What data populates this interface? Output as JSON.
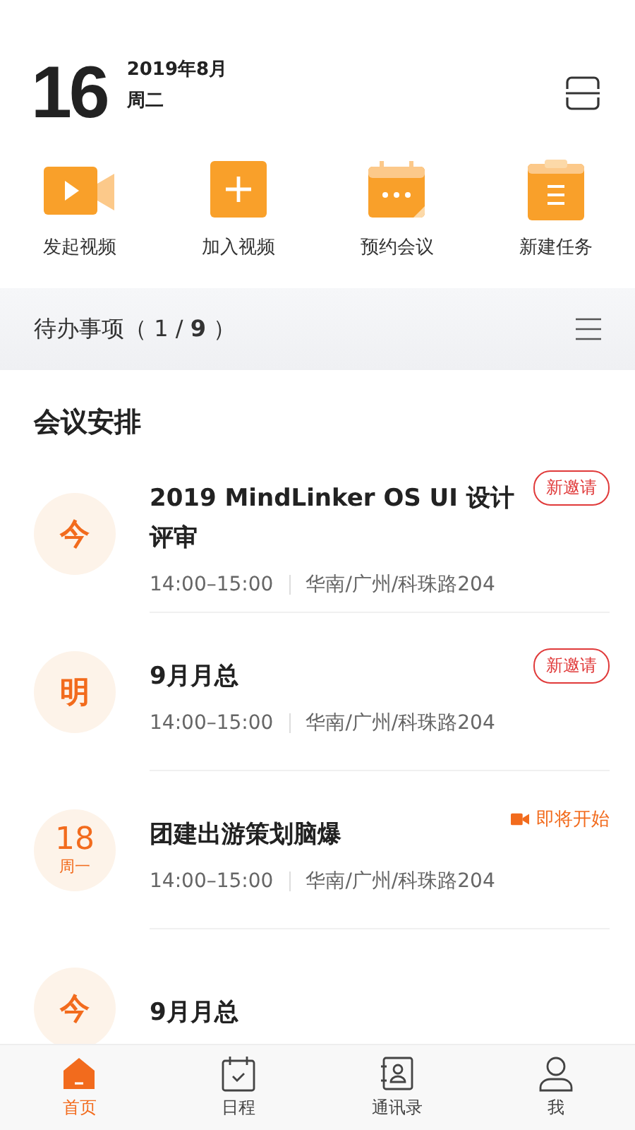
{
  "header": {
    "day": "16",
    "month": "2019年8月",
    "weekday": "周二"
  },
  "actions": [
    {
      "kind": "video",
      "label": "发起视频"
    },
    {
      "kind": "join",
      "label": "加入视频"
    },
    {
      "kind": "schedule",
      "label": "预约会议"
    },
    {
      "kind": "task",
      "label": "新建任务"
    }
  ],
  "todo": {
    "label": "待办事项（ 1 / **9** ）"
  },
  "section_title": "会议安排",
  "meetings": [
    {
      "day": "今",
      "title": "2019 MindLinker OS UI 设计评审",
      "time": "14:00–15:00",
      "place": "华南/广州/科珠路204",
      "badge": {
        "kind": "invite",
        "text": "新邀请"
      }
    },
    {
      "day": "明",
      "title": "9月月总",
      "time": "14:00–15:00",
      "place": "华南/广州/科珠路204",
      "badge": {
        "kind": "invite",
        "text": "新邀请"
      }
    },
    {
      "day": "18",
      "weekday": "周一",
      "title": "团建出游策划脑爆",
      "time": "14:00–15:00",
      "place": "华南/广州/科珠路204",
      "badge": {
        "kind": "starting",
        "text": "即将开始"
      }
    },
    {
      "day": "今",
      "title": "9月月总"
    }
  ],
  "tabs": [
    {
      "kind": "home",
      "label": "首页",
      "selected": true
    },
    {
      "kind": "calendar",
      "label": "日程",
      "selected": false
    },
    {
      "kind": "contacts",
      "label": "通讯录",
      "selected": false
    },
    {
      "kind": "me",
      "label": "我",
      "selected": false
    }
  ]
}
